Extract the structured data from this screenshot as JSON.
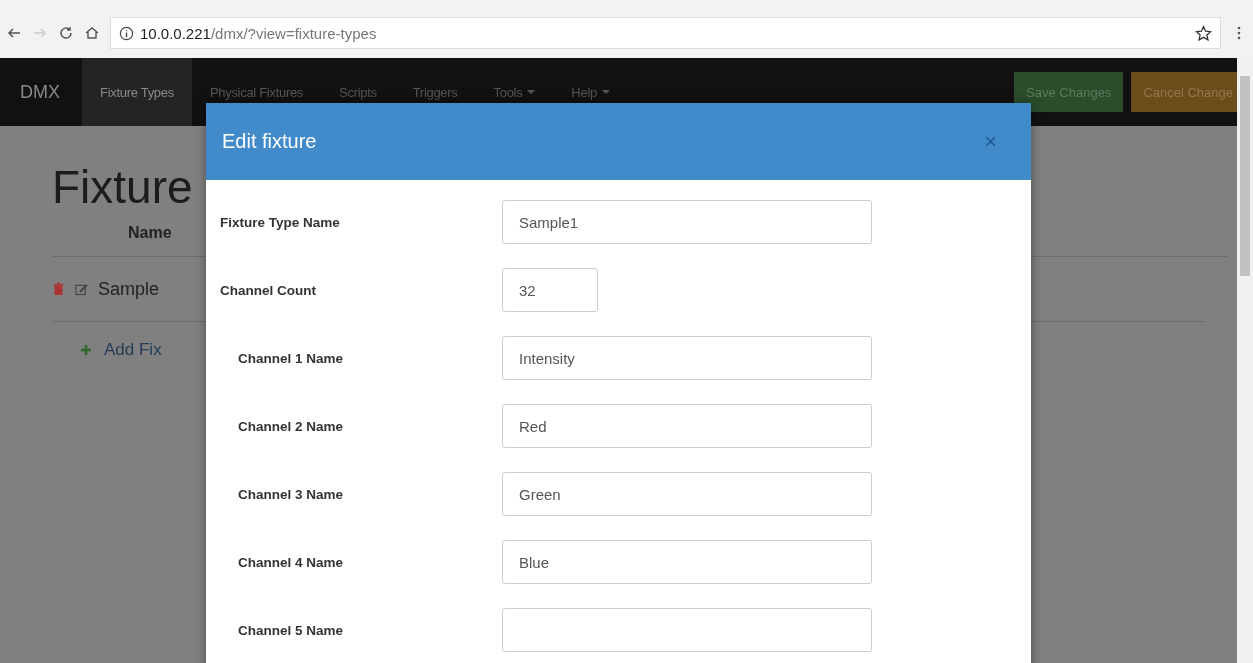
{
  "browser": {
    "url_host": "10.0.0.221",
    "url_path": "/dmx/?view=fixture-types"
  },
  "navbar": {
    "brand": "DMX",
    "items": [
      {
        "label": "Fixture Types",
        "selected": true,
        "kind": "link"
      },
      {
        "label": "Physical Fixtures",
        "selected": false,
        "kind": "link"
      },
      {
        "label": "Scripts",
        "selected": false,
        "kind": "link"
      },
      {
        "label": "Triggers",
        "selected": false,
        "kind": "link"
      },
      {
        "label": "Tools",
        "selected": false,
        "kind": "dropdown"
      },
      {
        "label": "Help",
        "selected": false,
        "kind": "dropdown"
      }
    ],
    "buttons": [
      {
        "label": "Save Changes",
        "kind": "save"
      },
      {
        "label": "Cancel Change",
        "kind": "cancel"
      }
    ]
  },
  "page": {
    "heading": "Fixture",
    "column": "Name",
    "rows": [
      "Sample"
    ],
    "add_link": "Add Fix"
  },
  "modal": {
    "title": "Edit fixture",
    "close": "×",
    "fields": [
      {
        "label": "Fixture Type Name",
        "value": "Sample1",
        "kind": "type-name"
      },
      {
        "label": "Channel Count",
        "value": "32",
        "kind": "count"
      },
      {
        "label": "Channel 1 Name",
        "value": "Intensity",
        "kind": "channel"
      },
      {
        "label": "Channel 2 Name",
        "value": "Red",
        "kind": "channel"
      },
      {
        "label": "Channel 3 Name",
        "value": "Green",
        "kind": "channel"
      },
      {
        "label": "Channel 4 Name",
        "value": "Blue",
        "kind": "channel"
      },
      {
        "label": "Channel 5 Name",
        "kind": "channel"
      }
    ]
  }
}
